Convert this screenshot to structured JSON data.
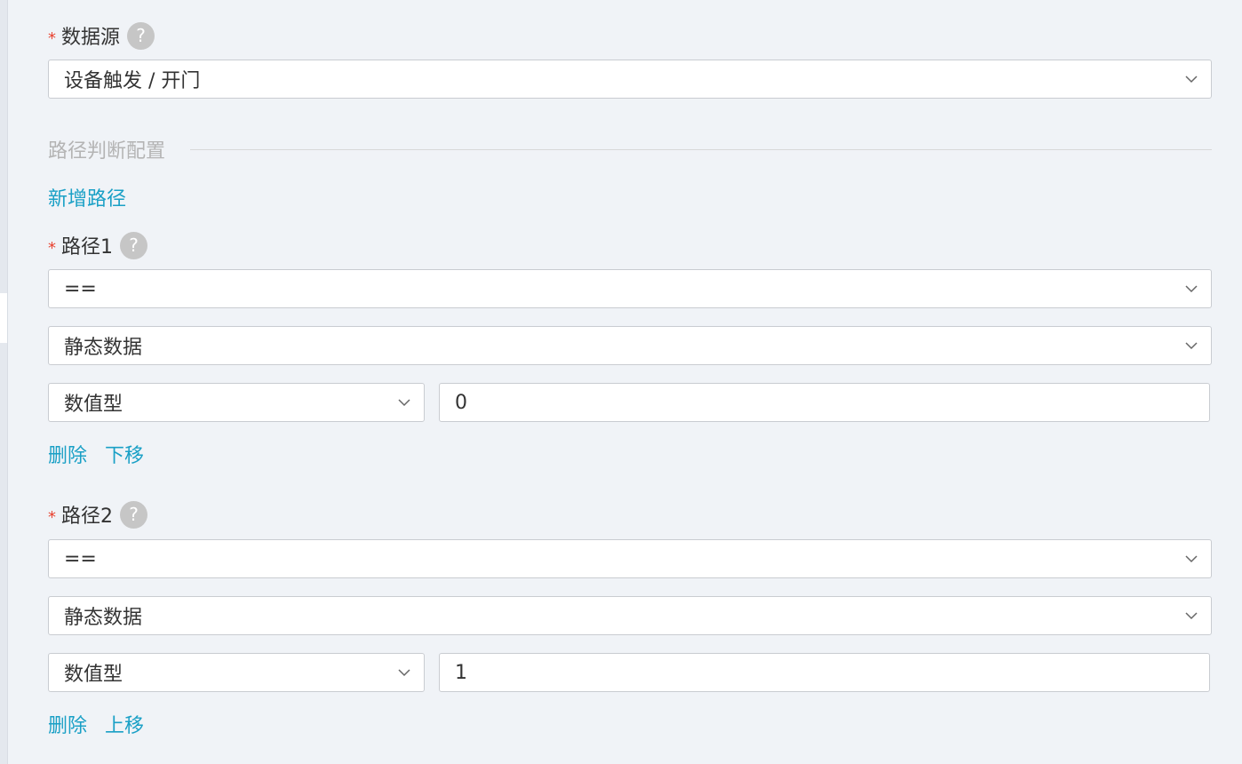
{
  "data_source": {
    "label": "数据源",
    "help": "?",
    "value": "设备触发 / 开门"
  },
  "section": {
    "title": "路径判断配置",
    "add_link": "新增路径"
  },
  "paths": [
    {
      "label": "路径1",
      "help": "?",
      "operator": "==",
      "data_type": "静态数据",
      "value_type": "数值型",
      "value": "0",
      "actions": {
        "delete": "删除",
        "move": "下移"
      }
    },
    {
      "label": "路径2",
      "help": "?",
      "operator": "==",
      "data_type": "静态数据",
      "value_type": "数值型",
      "value": "1",
      "actions": {
        "delete": "删除",
        "move": "上移"
      }
    }
  ],
  "required_mark": "*",
  "colors": {
    "link": "#1aa0c6",
    "required": "#e8412f",
    "help_bg": "#c6c6c6",
    "section_title": "#b4b4b4",
    "background": "#f0f3f7"
  }
}
